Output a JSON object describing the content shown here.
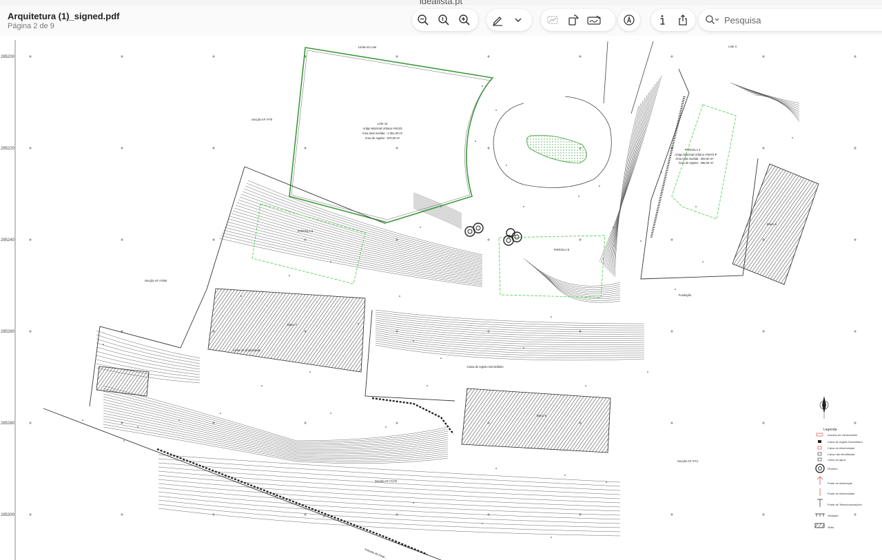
{
  "browser": {
    "url": "idealista.pt"
  },
  "document": {
    "title": "Arquitetura (1)_signed.pdf",
    "page_info": "Página 2 de 9"
  },
  "search": {
    "placeholder": "Pesquisa"
  },
  "icons": [
    "zoom-out-icon",
    "actual-size-icon",
    "zoom-in-icon",
    "markup-pen-icon",
    "chevron-down-icon",
    "highlight-icon",
    "rotate-icon",
    "signature-icon",
    "annotate-icon",
    "info-icon",
    "share-icon",
    "search-icon"
  ],
  "plan": {
    "coords": [
      "285200",
      "285220",
      "285240",
      "285260",
      "285280",
      "285300"
    ],
    "labels": {
      "lote_limite": "Limite do Lote",
      "lote_3": "Lote 3",
      "lote_11_title": "Lote 11",
      "lote_11_matricial": "Artigo Matricial Urbano nº6133",
      "lote_11_area_total": "Área total medida : 1.351,00 m²",
      "lote_11_area_registo": "Área de registo : 970,00 m²",
      "seccao_79": "Secção AF nº79",
      "seccao_394": "Secção AF nº394",
      "seccao_74": "Secção AF nº74",
      "seccao_175": "Secção AF nº175",
      "parcela_4": "PARCELA 4",
      "parcela_4_matricial": "Artigo Matricial Urbano nº5073-P",
      "parcela_4_area": "Área total medida : 293,00 m²",
      "parcela_4_registo": "Área de registo : 296,00 m²",
      "parcela_5": "PARCELA 5",
      "parcela_6": "PARCELA 6",
      "limite_propriedade": "Limite de propriedade",
      "bloco_6": "Bloco 6",
      "bloco_5": "Bloco 5",
      "bloco_7": "Bloco 7",
      "fundacao": "Fundação",
      "caixa_registo": "Caixa de registo Domiciliário",
      "estrada": "Estrada da Estal..."
    },
    "legend": {
      "title": "Legenda",
      "items": [
        "Armário de electricidade",
        "Caixa de registo Domiciliário",
        "Caixa de electricidade",
        "Caixa não identificada",
        "Caixa de água",
        "Pinheiro",
        "Poste de iluminação",
        "Poste de electricidade",
        "Poste de Telecomunicações",
        "Vedação",
        "Sebe"
      ]
    }
  }
}
